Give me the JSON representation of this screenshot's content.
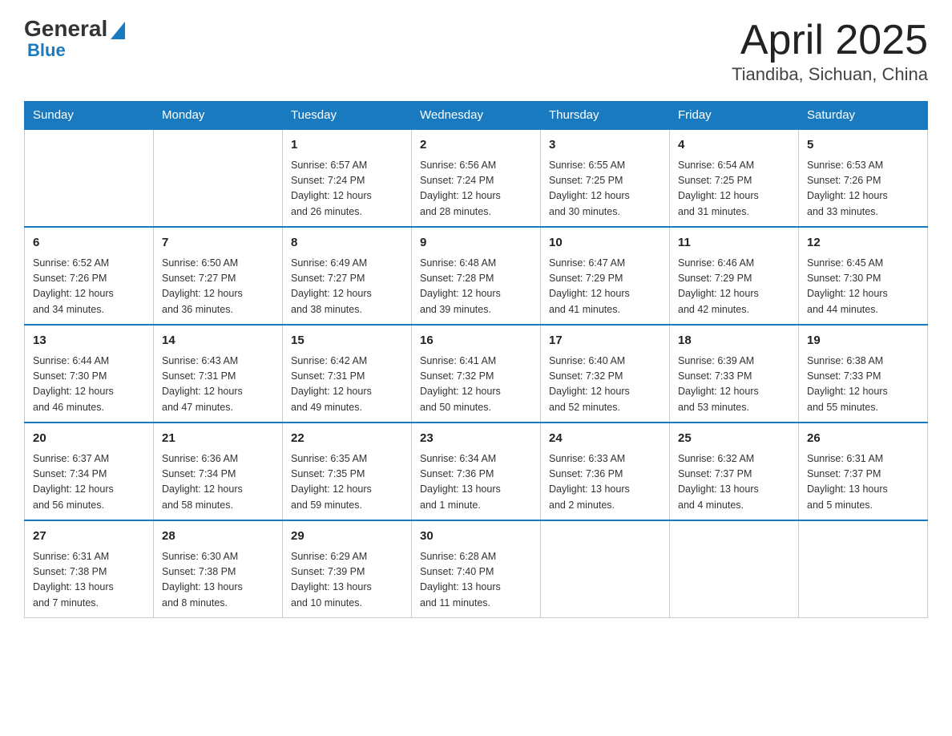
{
  "logo": {
    "general": "General",
    "blue": "Blue"
  },
  "title": "April 2025",
  "subtitle": "Tiandiba, Sichuan, China",
  "headers": [
    "Sunday",
    "Monday",
    "Tuesday",
    "Wednesday",
    "Thursday",
    "Friday",
    "Saturday"
  ],
  "weeks": [
    [
      {
        "day": "",
        "info": ""
      },
      {
        "day": "",
        "info": ""
      },
      {
        "day": "1",
        "info": "Sunrise: 6:57 AM\nSunset: 7:24 PM\nDaylight: 12 hours\nand 26 minutes."
      },
      {
        "day": "2",
        "info": "Sunrise: 6:56 AM\nSunset: 7:24 PM\nDaylight: 12 hours\nand 28 minutes."
      },
      {
        "day": "3",
        "info": "Sunrise: 6:55 AM\nSunset: 7:25 PM\nDaylight: 12 hours\nand 30 minutes."
      },
      {
        "day": "4",
        "info": "Sunrise: 6:54 AM\nSunset: 7:25 PM\nDaylight: 12 hours\nand 31 minutes."
      },
      {
        "day": "5",
        "info": "Sunrise: 6:53 AM\nSunset: 7:26 PM\nDaylight: 12 hours\nand 33 minutes."
      }
    ],
    [
      {
        "day": "6",
        "info": "Sunrise: 6:52 AM\nSunset: 7:26 PM\nDaylight: 12 hours\nand 34 minutes."
      },
      {
        "day": "7",
        "info": "Sunrise: 6:50 AM\nSunset: 7:27 PM\nDaylight: 12 hours\nand 36 minutes."
      },
      {
        "day": "8",
        "info": "Sunrise: 6:49 AM\nSunset: 7:27 PM\nDaylight: 12 hours\nand 38 minutes."
      },
      {
        "day": "9",
        "info": "Sunrise: 6:48 AM\nSunset: 7:28 PM\nDaylight: 12 hours\nand 39 minutes."
      },
      {
        "day": "10",
        "info": "Sunrise: 6:47 AM\nSunset: 7:29 PM\nDaylight: 12 hours\nand 41 minutes."
      },
      {
        "day": "11",
        "info": "Sunrise: 6:46 AM\nSunset: 7:29 PM\nDaylight: 12 hours\nand 42 minutes."
      },
      {
        "day": "12",
        "info": "Sunrise: 6:45 AM\nSunset: 7:30 PM\nDaylight: 12 hours\nand 44 minutes."
      }
    ],
    [
      {
        "day": "13",
        "info": "Sunrise: 6:44 AM\nSunset: 7:30 PM\nDaylight: 12 hours\nand 46 minutes."
      },
      {
        "day": "14",
        "info": "Sunrise: 6:43 AM\nSunset: 7:31 PM\nDaylight: 12 hours\nand 47 minutes."
      },
      {
        "day": "15",
        "info": "Sunrise: 6:42 AM\nSunset: 7:31 PM\nDaylight: 12 hours\nand 49 minutes."
      },
      {
        "day": "16",
        "info": "Sunrise: 6:41 AM\nSunset: 7:32 PM\nDaylight: 12 hours\nand 50 minutes."
      },
      {
        "day": "17",
        "info": "Sunrise: 6:40 AM\nSunset: 7:32 PM\nDaylight: 12 hours\nand 52 minutes."
      },
      {
        "day": "18",
        "info": "Sunrise: 6:39 AM\nSunset: 7:33 PM\nDaylight: 12 hours\nand 53 minutes."
      },
      {
        "day": "19",
        "info": "Sunrise: 6:38 AM\nSunset: 7:33 PM\nDaylight: 12 hours\nand 55 minutes."
      }
    ],
    [
      {
        "day": "20",
        "info": "Sunrise: 6:37 AM\nSunset: 7:34 PM\nDaylight: 12 hours\nand 56 minutes."
      },
      {
        "day": "21",
        "info": "Sunrise: 6:36 AM\nSunset: 7:34 PM\nDaylight: 12 hours\nand 58 minutes."
      },
      {
        "day": "22",
        "info": "Sunrise: 6:35 AM\nSunset: 7:35 PM\nDaylight: 12 hours\nand 59 minutes."
      },
      {
        "day": "23",
        "info": "Sunrise: 6:34 AM\nSunset: 7:36 PM\nDaylight: 13 hours\nand 1 minute."
      },
      {
        "day": "24",
        "info": "Sunrise: 6:33 AM\nSunset: 7:36 PM\nDaylight: 13 hours\nand 2 minutes."
      },
      {
        "day": "25",
        "info": "Sunrise: 6:32 AM\nSunset: 7:37 PM\nDaylight: 13 hours\nand 4 minutes."
      },
      {
        "day": "26",
        "info": "Sunrise: 6:31 AM\nSunset: 7:37 PM\nDaylight: 13 hours\nand 5 minutes."
      }
    ],
    [
      {
        "day": "27",
        "info": "Sunrise: 6:31 AM\nSunset: 7:38 PM\nDaylight: 13 hours\nand 7 minutes."
      },
      {
        "day": "28",
        "info": "Sunrise: 6:30 AM\nSunset: 7:38 PM\nDaylight: 13 hours\nand 8 minutes."
      },
      {
        "day": "29",
        "info": "Sunrise: 6:29 AM\nSunset: 7:39 PM\nDaylight: 13 hours\nand 10 minutes."
      },
      {
        "day": "30",
        "info": "Sunrise: 6:28 AM\nSunset: 7:40 PM\nDaylight: 13 hours\nand 11 minutes."
      },
      {
        "day": "",
        "info": ""
      },
      {
        "day": "",
        "info": ""
      },
      {
        "day": "",
        "info": ""
      }
    ]
  ]
}
